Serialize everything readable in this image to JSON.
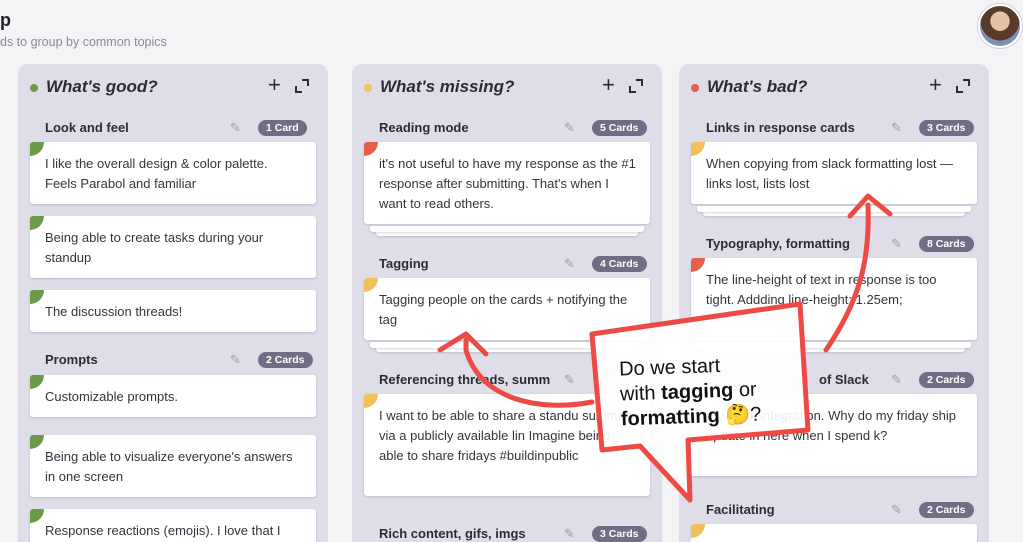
{
  "header": {
    "title": "p",
    "subtitle": "ds to group by common topics"
  },
  "colors": {
    "good": "#6c9a4a",
    "missing": "#f0c05c",
    "bad": "#e85e4c",
    "badge": "#6f6e86",
    "column": "#dedde8"
  },
  "columns": [
    {
      "title": "What's good?",
      "groups": [
        {
          "title": "Look and feel",
          "count": "1 Card",
          "cards": [
            "I like the overall design & color palette. Feels Parabol and familiar",
            "Being able to create tasks during your standup",
            "The discussion threads!"
          ]
        },
        {
          "title": "Prompts",
          "count": "2 Cards",
          "cards": [
            "Customizable prompts.",
            "Being able to visualize everyone's answers in one screen",
            "Response reactions (emojis). I love that I"
          ]
        }
      ]
    },
    {
      "title": "What's missing?",
      "groups": [
        {
          "title": "Reading mode",
          "count": "5 Cards",
          "cards": [
            "it's not useful to have my response as the #1 response after submitting. That's when I want to read others."
          ]
        },
        {
          "title": "Tagging",
          "count": "4 Cards",
          "cards": [
            "Tagging people on the cards + notifying the tag"
          ]
        },
        {
          "title": "Referencing threads, summ",
          "count": "",
          "cards": [
            "I want to be able to share a standu summary via a publicly available lin Imagine being able to share fridays #buildinpublic"
          ]
        },
        {
          "title": "Rich content, gifs, imgs",
          "count": "3 Cards",
          "cards": []
        }
      ]
    },
    {
      "title": "What's bad?",
      "groups": [
        {
          "title": "Links in response cards",
          "count": "3 Cards",
          "cards": [
            "When copying from slack formatting lost — links lost, lists lost"
          ]
        },
        {
          "title": "Typography, formatting",
          "count": "8 Cards",
          "cards": [
            "The line-height of text in response is too tight. Addding line-height: 1.25em;"
          ]
        },
        {
          "title": "of Slack",
          "count": "2 Cards",
          "cards": [
            "my slack integration. Why do my friday ship update in here when I spend k?"
          ]
        },
        {
          "title": "Facilitating",
          "count": "2 Cards",
          "cards": []
        }
      ]
    }
  ],
  "annotation": {
    "line1": "Do we start",
    "line2_prefix": "with ",
    "line2_bold": "tagging",
    "line2_suffix": " or",
    "line3_bold": "formatting",
    "line3_emoji": "🤔?"
  }
}
